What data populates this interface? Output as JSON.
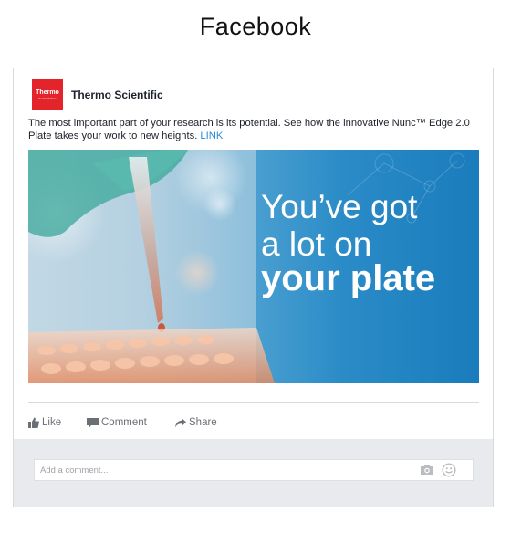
{
  "page": {
    "title": "Facebook"
  },
  "post": {
    "brand_name": "Thermo Scientific",
    "logo": {
      "main": "Thermo",
      "sub": "SCIENTIFIC",
      "color": "#e3242b"
    },
    "text": "The most important part of your research is its potential. See how the innovative Nunc™ Edge 2.0 Plate takes your work to new heights.",
    "link_label": "LINK",
    "image": {
      "line1": "You’ve got",
      "line2": "a lot on",
      "line3": "your plate"
    }
  },
  "actions": {
    "like": "Like",
    "comment": "Comment",
    "share": "Share"
  },
  "comment": {
    "placeholder": "Add a comment...",
    "camera_icon": "camera-icon",
    "emoji_icon": "smiley-icon"
  },
  "colors": {
    "link": "#2b8bd6",
    "action_text": "#6b6f76",
    "comment_bg": "#e9eaed"
  }
}
